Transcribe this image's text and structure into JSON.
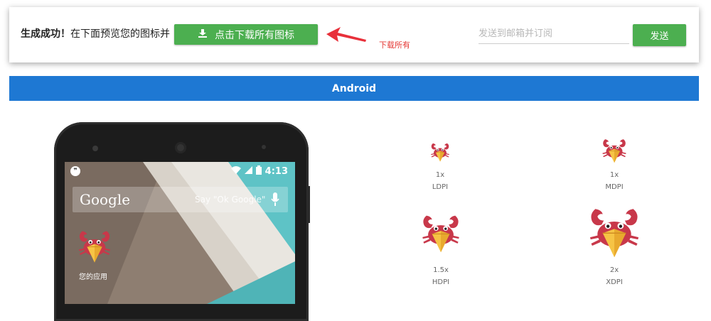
{
  "topbar": {
    "success_bold": "生成成功！",
    "success_rest": "在下面预览您的图标并",
    "download_label": "点击下载所有图标",
    "annotation": "下载所有",
    "email_placeholder": "发送到邮箱并订阅",
    "send_label": "发送"
  },
  "platform": {
    "title": "Android"
  },
  "phone": {
    "time": "4:13",
    "google": "Google",
    "ok_google": "Say \"Ok Google\"",
    "app_label": "您的应用"
  },
  "densities": [
    {
      "scale": "1x",
      "name": "LDPI"
    },
    {
      "scale": "1x",
      "name": "MDPI"
    },
    {
      "scale": "1.5x",
      "name": "HDPI"
    },
    {
      "scale": "2x",
      "name": "XDPI"
    }
  ],
  "colors": {
    "green": "#4caf50",
    "blue": "#1e78d3",
    "crab_red": "#c8384a",
    "beak_yellow": "#f6c445",
    "annotation_red": "#e53935"
  },
  "icons": {
    "download": "download-icon",
    "arrow": "red-arrow-icon",
    "crab": "crab-app-icon",
    "mic": "microphone-icon"
  }
}
